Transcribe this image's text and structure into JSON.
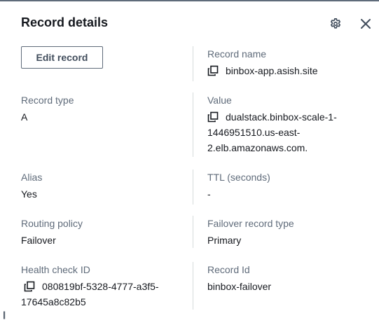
{
  "panel": {
    "title": "Record details",
    "edit_button_label": "Edit record"
  },
  "icons": {
    "settings": "gear-icon",
    "close": "close-icon",
    "copy": "copy-icon",
    "resize": "resize-handle-icon"
  },
  "resize_handle": "||",
  "fields": {
    "record_name": {
      "label": "Record name",
      "value": "binbox-app.asish.site"
    },
    "record_type": {
      "label": "Record type",
      "value": "A"
    },
    "value": {
      "label": "Value",
      "value_lines": [
        "dualstack.binbox-scale-1-",
        "1446951510.us-east-",
        "2.elb.amazonaws.com."
      ]
    },
    "alias": {
      "label": "Alias",
      "value": "Yes"
    },
    "ttl": {
      "label": "TTL (seconds)",
      "value": "-"
    },
    "routing_policy": {
      "label": "Routing policy",
      "value": "Failover"
    },
    "failover_record_type": {
      "label": "Failover record type",
      "value": "Primary"
    },
    "health_check_id": {
      "label": "Health check ID",
      "value_lines": [
        "080819bf-5328-4777-a3f5-",
        "17645a8c82b5"
      ]
    },
    "record_id": {
      "label": "Record Id",
      "value": "binbox-failover"
    }
  },
  "colors": {
    "text": "#16191f",
    "label": "#5f6b7a",
    "divider": "#d5dbdb",
    "button_border": "#5f6b7a"
  }
}
